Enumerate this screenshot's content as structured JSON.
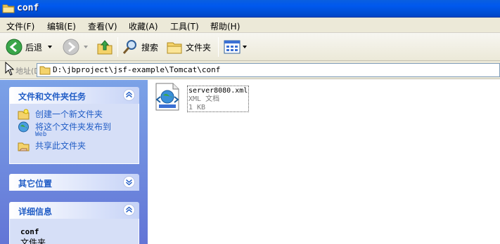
{
  "window": {
    "title": "conf"
  },
  "menu": {
    "items": [
      "文件(F)",
      "编辑(E)",
      "查看(V)",
      "收藏(A)",
      "工具(T)",
      "帮助(H)"
    ]
  },
  "toolbar": {
    "back_label": "后退",
    "search_label": "搜索",
    "folders_label": "文件夹"
  },
  "address": {
    "label": "地址(D)",
    "value": "D:\\jbproject\\jsf-example\\Tomcat\\conf"
  },
  "taskpane": {
    "file_tasks": {
      "title": "文件和文件夹任务",
      "items": [
        {
          "label": "创建一个新文件夹",
          "icon": "new-folder-icon"
        },
        {
          "label": "将这个文件夹发布到",
          "sublabel": "Web",
          "icon": "publish-web-icon"
        },
        {
          "label": "共享此文件夹",
          "icon": "share-folder-icon"
        }
      ]
    },
    "other_places": {
      "title": "其它位置"
    },
    "details": {
      "title": "详细信息",
      "name": "conf",
      "type": "文件夹"
    }
  },
  "files": [
    {
      "name": "server8080.xml",
      "type": "XML 文档",
      "size": "1 KB",
      "icon": "xml-document-icon"
    }
  ]
}
